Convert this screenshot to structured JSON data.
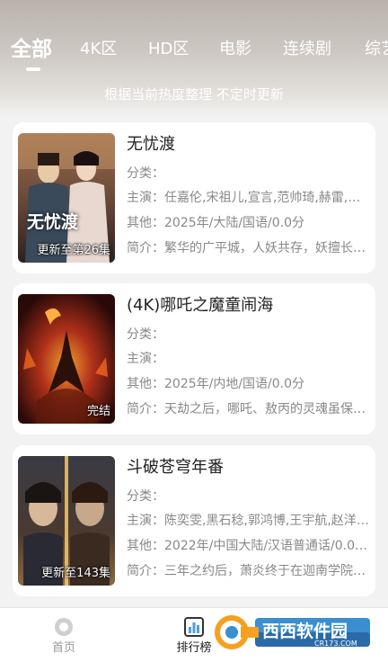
{
  "tabs": [
    {
      "label": "全部",
      "active": true
    },
    {
      "label": "4K区"
    },
    {
      "label": "HD区"
    },
    {
      "label": "电影"
    },
    {
      "label": "连续剧"
    },
    {
      "label": "综艺"
    }
  ],
  "subtitle": "根据当前热度整理 不定时更新",
  "items": [
    {
      "title": "无忧渡",
      "category_label": "分类：",
      "cast": "主演：任嘉伦,宋祖儿,宣言,范帅琦,赫雷,刘…",
      "other": "其他：2025年/大陆/国语/0.0分",
      "intro": "简介：繁华的广平城，人妖共存，妖擅长…",
      "badge": "更新至第26集",
      "poster_text": "无忧渡"
    },
    {
      "title": "(4K)哪吒之魔童闹海",
      "category_label": "分类：",
      "cast": "主演：",
      "other": "其他：2025年/内地/国语/0.0分",
      "intro": "简介：天劫之后，哪吒、敖丙的灵魂虽保…",
      "badge": "完结",
      "poster_text": ""
    },
    {
      "title": "斗破苍穹年番",
      "category_label": "分类：",
      "cast": "主演：陈奕雯,黑石稔,郭鸿博,王宇航,赵洋,…",
      "other": "其他：2022年/中国大陆/汉语普通话/0.0…",
      "intro": "简介：三年之约后，萧炎终于在迦南学院…",
      "badge": "更新至143集",
      "poster_text": ""
    }
  ],
  "nav": {
    "home": "首页",
    "ranking": "排行榜"
  },
  "watermark": {
    "name": "西西软件园",
    "domain": "CR173.COM"
  }
}
